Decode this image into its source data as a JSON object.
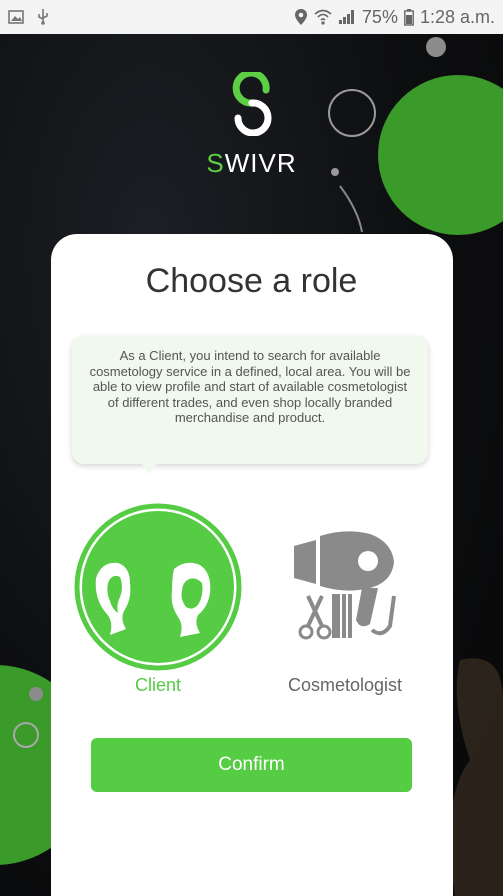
{
  "status_bar": {
    "battery": "75%",
    "time": "1:28 a.m."
  },
  "brand": {
    "name_first": "S",
    "name_rest": "WIVR"
  },
  "page": {
    "title": "Choose a role"
  },
  "description": "As a Client, you intend to search for available cosmetology service in a defined, local area. You will be able to view profile and start of available cosmetologist of different trades, and even shop locally branded merchandise and product.",
  "roles": [
    {
      "label": "Client",
      "selected": true
    },
    {
      "label": "Cosmetologist",
      "selected": false
    }
  ],
  "confirm_label": "Confirm",
  "colors": {
    "accent": "#55cc44",
    "background": "#0c0c0c",
    "deco_green": "#3a9a2a",
    "inactive": "#8a8a8a"
  },
  "icons": [
    "image-icon",
    "usb-icon",
    "location-icon",
    "wifi-icon",
    "signal-icon",
    "battery-icon",
    "client-icon",
    "hair-dryer-icon",
    "scissors-icon",
    "comb-icon"
  ]
}
